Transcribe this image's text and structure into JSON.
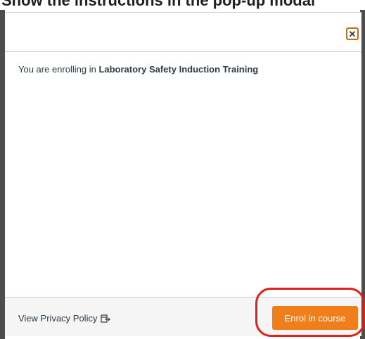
{
  "top_strip": {
    "text": "Show the instructions in the pop-up modal"
  },
  "modal": {
    "close_glyph": "✕",
    "body": {
      "prefix": "You are enrolling in ",
      "course_name": "Laboratory Safety Induction Training"
    },
    "footer": {
      "privacy_label": "View Privacy Policy",
      "privacy_icon": "external-link-icon",
      "enrol_label": "Enrol in course"
    }
  },
  "colors": {
    "accent": "#f07f1b",
    "close_focus_border": "#c66f10",
    "highlight_ring": "#e0201b",
    "frame": "#4d4d4d",
    "footer_bg": "#f5f5f5"
  }
}
